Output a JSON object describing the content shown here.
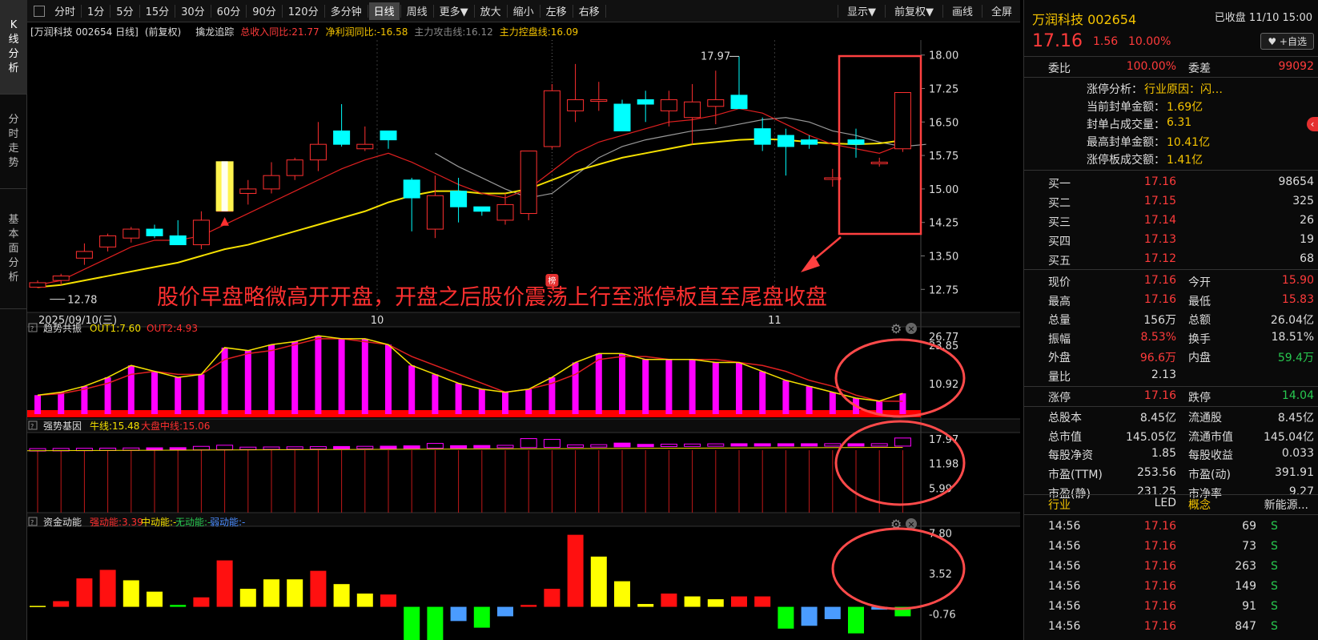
{
  "sidebar": [
    {
      "label": "K\n线\n分\n析",
      "active": true
    },
    {
      "label": "分\n时\n走\n势",
      "active": false
    },
    {
      "label": "基\n本\n面\n分\n析",
      "active": false
    }
  ],
  "toolbar": {
    "periods": [
      "分时",
      "1分",
      "5分",
      "15分",
      "30分",
      "60分",
      "90分",
      "120分",
      "多分钟",
      "日线",
      "周线",
      "更多▼"
    ],
    "active": "日线",
    "actions": [
      "放大",
      "缩小",
      "左移",
      "右移"
    ],
    "right": [
      "显示▼",
      "前复权▼",
      "画线",
      "全屏"
    ]
  },
  "info": {
    "stock": "[万润科技 002654 日线]",
    "adjust": "(前复权)",
    "indicator": "擒龙追踪",
    "rev": "总收入同比:21.77",
    "profit": "净利润同比:-16.58",
    "attack": "主力攻击线:16.12",
    "control": "主力控盘线:16.09"
  },
  "annotation": "股价早盘略微高开开盘，开盘之后股价震荡上行至涨停板直至尾盘收盘",
  "chart_labels": {
    "high": "17.97",
    "low": "12.78",
    "date_start": "2025/09/10(三)",
    "month_10": "10",
    "month_11": "11",
    "bang_badge": "榜"
  },
  "chart_data": [
    {
      "type": "candlestick",
      "name": "price",
      "y_ticks": [
        "18.00",
        "17.25",
        "16.50",
        "15.75",
        "15.00",
        "14.25",
        "13.50",
        "12.75"
      ],
      "ylim": [
        12.45,
        18.3
      ],
      "ohlc": [
        [
          12.8,
          12.95,
          12.78,
          12.9
        ],
        [
          12.95,
          13.1,
          12.85,
          13.05
        ],
        [
          13.45,
          13.78,
          13.3,
          13.6
        ],
        [
          13.7,
          14.0,
          13.6,
          13.95
        ],
        [
          13.9,
          14.15,
          13.8,
          14.1
        ],
        [
          14.1,
          14.2,
          13.9,
          13.95
        ],
        [
          13.95,
          14.3,
          13.75,
          13.75
        ],
        [
          13.75,
          14.5,
          13.65,
          14.3
        ],
        [
          14.5,
          15.2,
          14.5,
          15.2
        ],
        [
          14.9,
          15.2,
          14.65,
          15.0
        ],
        [
          15.0,
          15.6,
          14.9,
          15.3
        ],
        [
          15.3,
          15.7,
          15.2,
          15.65
        ],
        [
          15.65,
          16.5,
          15.4,
          16.0
        ],
        [
          16.3,
          16.9,
          15.95,
          16.0
        ],
        [
          15.9,
          16.4,
          15.85,
          16.0
        ],
        [
          16.3,
          16.3,
          15.9,
          16.1
        ],
        [
          15.2,
          15.25,
          14.05,
          14.8
        ],
        [
          14.1,
          15.3,
          13.9,
          14.85
        ],
        [
          14.95,
          15.25,
          14.25,
          14.6
        ],
        [
          14.6,
          14.55,
          14.4,
          14.5
        ],
        [
          14.3,
          14.9,
          14.2,
          14.65
        ],
        [
          14.45,
          15.6,
          14.3,
          15.85
        ],
        [
          15.95,
          17.35,
          15.9,
          17.2
        ],
        [
          16.75,
          17.8,
          16.5,
          17.0
        ],
        [
          17.0,
          17.4,
          16.75,
          17.0
        ],
        [
          16.9,
          17.0,
          16.55,
          16.3
        ],
        [
          17.0,
          17.2,
          16.5,
          16.9
        ],
        [
          16.75,
          17.2,
          16.4,
          17.0
        ],
        [
          16.6,
          17.35,
          16.0,
          16.95
        ],
        [
          16.85,
          17.65,
          16.45,
          17.0
        ],
        [
          17.1,
          17.97,
          16.8,
          16.8
        ],
        [
          16.35,
          16.6,
          15.85,
          16.0
        ],
        [
          16.2,
          16.35,
          15.3,
          15.95
        ],
        [
          16.1,
          16.2,
          15.9,
          16.0
        ],
        [
          15.25,
          15.45,
          15.05,
          15.25
        ],
        [
          16.1,
          16.35,
          15.7,
          16.0
        ],
        [
          15.6,
          15.7,
          15.5,
          15.6
        ],
        [
          15.9,
          17.16,
          15.83,
          17.16
        ]
      ],
      "ma_red": [
        12.85,
        12.95,
        13.2,
        13.45,
        13.7,
        13.85,
        13.85,
        13.95,
        14.2,
        14.45,
        14.7,
        14.95,
        15.2,
        15.45,
        15.65,
        15.8,
        15.6,
        15.35,
        15.1,
        14.9,
        14.8,
        15.0,
        15.4,
        15.8,
        16.05,
        16.2,
        16.35,
        16.5,
        16.55,
        16.65,
        16.8,
        16.7,
        16.45,
        16.2,
        16.0,
        15.9,
        15.8,
        16.0
      ],
      "ma_yel": [
        12.8,
        12.85,
        12.95,
        13.05,
        13.15,
        13.25,
        13.35,
        13.5,
        13.65,
        13.75,
        13.9,
        14.05,
        14.2,
        14.35,
        14.5,
        14.7,
        14.85,
        14.95,
        14.95,
        14.9,
        14.9,
        15.0,
        15.2,
        15.4,
        15.55,
        15.7,
        15.8,
        15.9,
        16.0,
        16.05,
        16.1,
        16.12,
        16.1,
        16.05,
        16.02,
        16.0,
        16.02,
        16.09
      ],
      "ma_gray_from": 17,
      "ma_gray": [
        15.8,
        15.5,
        15.25,
        15.0,
        14.8,
        14.9,
        15.3,
        15.7,
        15.95,
        16.1,
        16.2,
        16.3,
        16.35,
        16.45,
        16.55,
        16.6,
        16.5,
        16.3,
        16.2,
        16.05,
        15.95,
        16.0
      ]
    },
    {
      "type": "bar",
      "name": "趋势共振",
      "legend": [
        "OUT1:7.60",
        "OUT2:4.93"
      ],
      "y_ticks": [
        "26.77",
        "23.85",
        "10.92"
      ],
      "ylim": [
        -1,
        30
      ],
      "out1": [
        7,
        8,
        10,
        13,
        17,
        15,
        13,
        14,
        23,
        22,
        24,
        25,
        27,
        26,
        26,
        24,
        17,
        14,
        11,
        9,
        8,
        9,
        13,
        18,
        21,
        21,
        19,
        19,
        19,
        18,
        18,
        15,
        12,
        10,
        8,
        6,
        5,
        7.6
      ],
      "out2": [
        7,
        7.5,
        9,
        11,
        14,
        15,
        14,
        14,
        19,
        21,
        22,
        24,
        26,
        26,
        25,
        24,
        20,
        17,
        14,
        11,
        8,
        9,
        11,
        14,
        19,
        20,
        20,
        19,
        19,
        19,
        18,
        17,
        15,
        12,
        10,
        7,
        5,
        4.93
      ]
    },
    {
      "type": "bar",
      "name": "强势基因",
      "legend": [
        "牛线:15.48",
        "大盘中线:15.06"
      ],
      "y_ticks": [
        "17.97",
        "11.98",
        "5.99"
      ],
      "ylim": [
        0,
        19.5
      ]
    },
    {
      "type": "bar",
      "name": "资金动能",
      "legend": [
        "强动能:3.39",
        "中动能:-",
        "无动能:-",
        "弱动能:-"
      ],
      "y_ticks": [
        "7.80",
        "3.52",
        "-0.76"
      ],
      "ylim": [
        -3.5,
        8.5
      ],
      "values": [
        0.1,
        0.6,
        3.0,
        3.9,
        2.8,
        1.6,
        0.2,
        1.0,
        4.9,
        1.9,
        2.9,
        2.9,
        3.8,
        2.4,
        1.4,
        1.3,
        -3.5,
        -3.8,
        -1.5,
        -2.2,
        -1.0,
        0.2,
        1.9,
        7.6,
        5.3,
        2.7,
        0.3,
        1.4,
        1.1,
        0.8,
        1.1,
        1.1,
        -2.3,
        -2.0,
        -1.3,
        -2.8,
        -0.3,
        -1.0,
        3.39
      ],
      "colors": [
        "y",
        "r",
        "r",
        "r",
        "y",
        "y",
        "g",
        "r",
        "r",
        "y",
        "y",
        "y",
        "r",
        "y",
        "y",
        "r",
        "g",
        "g",
        "b",
        "g",
        "b",
        "r",
        "r",
        "r",
        "y",
        "y",
        "y",
        "r",
        "y",
        "y",
        "r",
        "r",
        "g",
        "b",
        "b",
        "g",
        "b",
        "g",
        "r"
      ]
    }
  ],
  "quote": {
    "name": "万润科技 002654",
    "status": "已收盘 11/10 15:00",
    "price": "17.16",
    "chg": "1.56",
    "pct": "10.00%",
    "add": "+自选",
    "weibi_l": "委比",
    "weibi": "100.00%",
    "weicha_l": "委差",
    "weicha": "99092",
    "zt": [
      [
        "涨停分析：",
        "行业原因：闪…"
      ],
      [
        "当前封单金额：",
        "1.69亿"
      ],
      [
        "封单占成交量：",
        "6.31"
      ],
      [
        "最高封单金额：",
        "10.41亿"
      ],
      [
        "涨停板成交额：",
        "1.41亿"
      ]
    ],
    "buy": [
      [
        "买一",
        "17.16",
        "98654"
      ],
      [
        "买二",
        "17.15",
        "325"
      ],
      [
        "买三",
        "17.14",
        "26"
      ],
      [
        "买四",
        "17.13",
        "19"
      ],
      [
        "买五",
        "17.12",
        "68"
      ]
    ],
    "stats": [
      [
        "现价",
        "17.16",
        "今开",
        "15.90"
      ],
      [
        "最高",
        "17.16",
        "最低",
        "15.83"
      ],
      [
        "总量",
        "156万",
        "总额",
        "26.04亿"
      ],
      [
        "振幅",
        "8.53%",
        "换手",
        "18.51%"
      ],
      [
        "外盘",
        "96.6万",
        "内盘",
        "59.4万"
      ],
      [
        "量比",
        "2.13",
        "",
        ""
      ],
      [
        "涨停",
        "17.16",
        "跌停",
        "14.04"
      ],
      [
        "总股本",
        "8.45亿",
        "流通股",
        "8.45亿"
      ],
      [
        "总市值",
        "145.05亿",
        "流通市值",
        "145.04亿"
      ],
      [
        "每股净资",
        "1.85",
        "每股收益",
        "0.033"
      ],
      [
        "市盈(TTM)",
        "253.56",
        "市盈(动)",
        "391.91"
      ],
      [
        "市盈(静)",
        "231.25",
        "市净率",
        "9.27"
      ]
    ],
    "industry": [
      "行业",
      "LED",
      "概念",
      "新能源..."
    ],
    "ticks": [
      [
        "14:56",
        "17.16",
        "69",
        "S"
      ],
      [
        "14:56",
        "17.16",
        "73",
        "S"
      ],
      [
        "14:56",
        "17.16",
        "263",
        "S"
      ],
      [
        "14:56",
        "17.16",
        "149",
        "S"
      ],
      [
        "14:56",
        "17.16",
        "91",
        "S"
      ],
      [
        "14:56",
        "17.16",
        "847",
        "S"
      ]
    ]
  }
}
